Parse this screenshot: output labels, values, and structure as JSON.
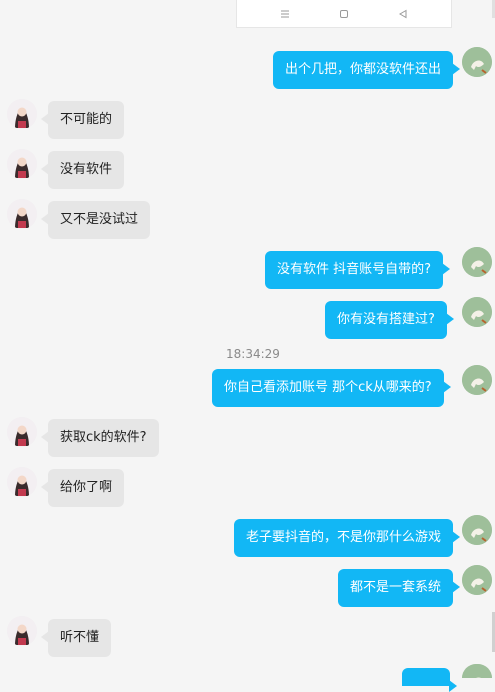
{
  "colors": {
    "outgoing": "#12b7f5",
    "incoming": "#e6e6e6",
    "background": "#f5f5f5"
  },
  "navbar": {
    "menu_icon": "menu-lines-icon",
    "home_icon": "square-home-icon",
    "back_icon": "triangle-back-icon"
  },
  "messages": [
    {
      "side": "out",
      "text": "出个几把，你都没软件还出"
    },
    {
      "side": "in",
      "text": "不可能的"
    },
    {
      "side": "in",
      "text": "没有软件"
    },
    {
      "side": "in",
      "text": "又不是没试过"
    },
    {
      "side": "out",
      "text": "没有软件  抖音账号自带的?"
    },
    {
      "side": "out",
      "text": "你有没有搭建过?"
    },
    {
      "side": "out",
      "text": "你自己看添加账号  那个ck从哪来的?"
    },
    {
      "side": "in",
      "text": "获取ck的软件?"
    },
    {
      "side": "in",
      "text": "给你了啊"
    },
    {
      "side": "out",
      "text": "老子要抖音的，不是你那什么游戏"
    },
    {
      "side": "out",
      "text": "都不是一套系统"
    },
    {
      "side": "in",
      "text": "听不懂"
    },
    {
      "side": "out",
      "text": ""
    }
  ],
  "timestamp": "18:34:29"
}
